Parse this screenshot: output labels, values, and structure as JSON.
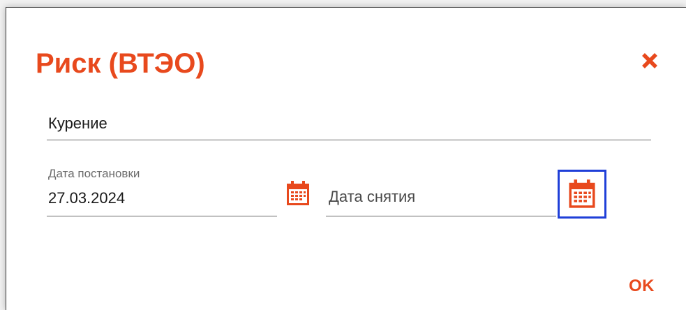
{
  "dialog": {
    "title": "Риск (ВТЭО)",
    "close_icon": "close-icon",
    "accent_color": "#e8491d",
    "focus_color": "#1f3fd8"
  },
  "risk_field": {
    "value": "Курение"
  },
  "date_start": {
    "label": "Дата постановки",
    "value": "27.03.2024",
    "icon": "calendar-icon"
  },
  "date_end": {
    "placeholder": "Дата снятия",
    "value": "",
    "icon": "calendar-icon"
  },
  "actions": {
    "ok_label": "OK"
  }
}
